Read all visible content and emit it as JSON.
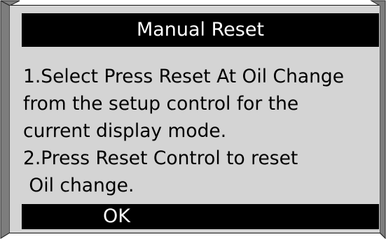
{
  "dialog": {
    "title": "Manual Reset",
    "message_lines": [
      "1.Select Press Reset At Oil Change",
      "from the setup control for the",
      "current display mode.",
      "2.Press Reset Control to reset",
      " Oil change."
    ],
    "ok_label": "OK"
  },
  "colors": {
    "screen_bg": "#d4d4d4",
    "bezel": "#8a8a8a",
    "bar_bg": "#000000",
    "bar_text": "#ffffff",
    "text": "#000000"
  }
}
